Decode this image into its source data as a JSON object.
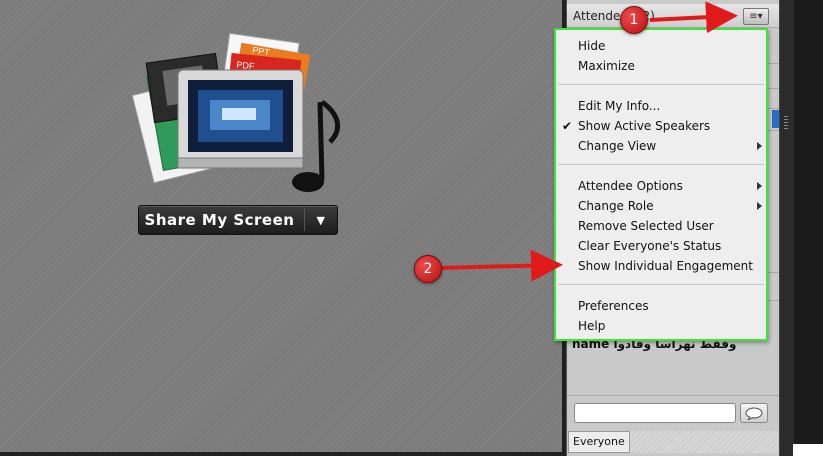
{
  "stage": {
    "share_button_label": "Share My Screen",
    "share_dropdown_glyph": "▼",
    "art_labels": {
      "ppt": "PPT",
      "pdf": "PDF"
    }
  },
  "attendees_panel": {
    "title": "Attendees (2)",
    "attendee_name": "name وفقط نهراسا وفادوا",
    "menu_button_glyph": "≡▾"
  },
  "options_menu": {
    "groups": [
      [
        {
          "label": "Hide"
        },
        {
          "label": "Maximize"
        }
      ],
      [
        {
          "label": "Edit My Info..."
        },
        {
          "label": "Show Active Speakers",
          "checked": true
        },
        {
          "label": "Change View",
          "submenu": true
        }
      ],
      [
        {
          "label": "Attendee Options",
          "submenu": true
        },
        {
          "label": "Change Role",
          "submenu": true
        },
        {
          "label": "Remove Selected User"
        },
        {
          "label": "Clear Everyone's Status"
        },
        {
          "label": "Show Individual Engagement"
        }
      ],
      [
        {
          "label": "Preferences"
        },
        {
          "label": "Help"
        }
      ]
    ],
    "check_glyph": "✔",
    "border_color": "#3fe23a"
  },
  "chat": {
    "recipient_tab": "Everyone",
    "input_value": "",
    "send_icon": "speech-bubble-icon"
  },
  "annotations": {
    "callout_1": "1",
    "callout_2": "2",
    "callout_color": "#d62222"
  }
}
